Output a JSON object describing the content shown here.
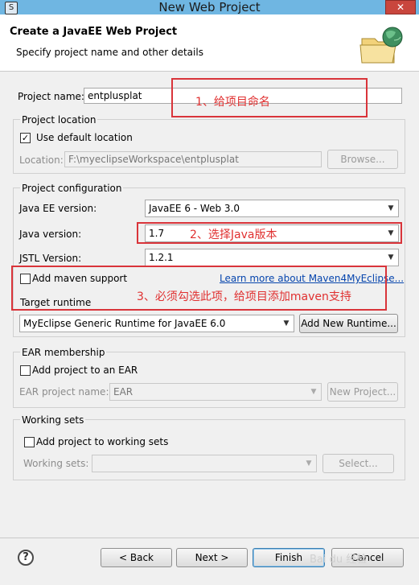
{
  "window": {
    "title": "New Web Project",
    "close": "✕"
  },
  "header": {
    "title": "Create a JavaEE Web Project",
    "subtitle": "Specify project name and other details"
  },
  "project_name": {
    "label": "Project name:",
    "value": "entplusplat"
  },
  "project_location": {
    "group_label": "Project location",
    "use_default_label": "Use default location",
    "use_default_checked": true,
    "location_label": "Location:",
    "location_value": "F:\\myeclipseWorkspace\\entplusplat",
    "browse_label": "Browse..."
  },
  "project_config": {
    "group_label": "Project configuration",
    "javaee_label": "Java EE version:",
    "javaee_value": "JavaEE 6 - Web 3.0",
    "java_label": "Java version:",
    "java_value": "1.7",
    "jstl_label": "JSTL Version:",
    "jstl_value": "1.2.1",
    "maven_label": "Add maven support",
    "maven_link": "Learn more about Maven4MyEclipse...",
    "runtime_label": "Target runtime",
    "runtime_value": "MyEclipse Generic Runtime for JavaEE 6.0",
    "add_runtime_label": "Add New Runtime..."
  },
  "ear": {
    "group_label": "EAR membership",
    "add_label": "Add project to an EAR",
    "name_label": "EAR project name:",
    "name_value": "EAR",
    "new_project_label": "New Project..."
  },
  "working_sets": {
    "group_label": "Working sets",
    "add_label": "Add project to working sets",
    "sets_label": "Working sets:",
    "select_label": "Select..."
  },
  "buttons": {
    "back": "< Back",
    "next": "Next >",
    "finish": "Finish",
    "cancel": "Cancel"
  },
  "annotations": {
    "note1": "1、给项目命名",
    "note2": "2、选择Java版本",
    "note3": "3、必须勾选此项，给项目添加maven支持"
  },
  "watermark": "Bai du 经验",
  "colors": {
    "annotation": "#d9343a",
    "link": "#0645ad",
    "titlebar": "#6fb6e2"
  }
}
